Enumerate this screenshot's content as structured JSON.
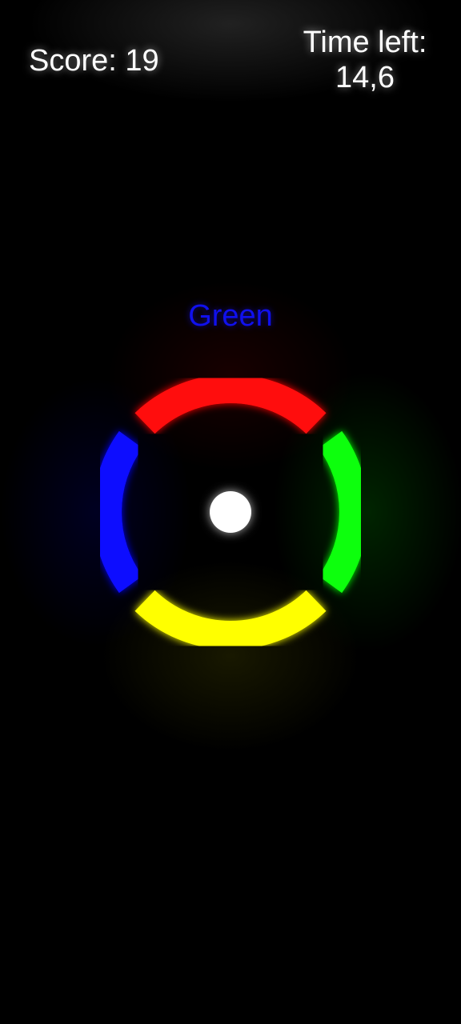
{
  "hud": {
    "score": "Score: 19",
    "time_label": "Time left:",
    "time_value": "14,6"
  },
  "target": {
    "word": "Green",
    "word_color": "#1010ee"
  },
  "ring": {
    "segments": [
      {
        "name": "red",
        "color": "#ff1010"
      },
      {
        "name": "green",
        "color": "#10ff10"
      },
      {
        "name": "yellow",
        "color": "#ffff00"
      },
      {
        "name": "blue",
        "color": "#1010ff"
      }
    ]
  },
  "ball": {
    "color": "#ffffff"
  }
}
